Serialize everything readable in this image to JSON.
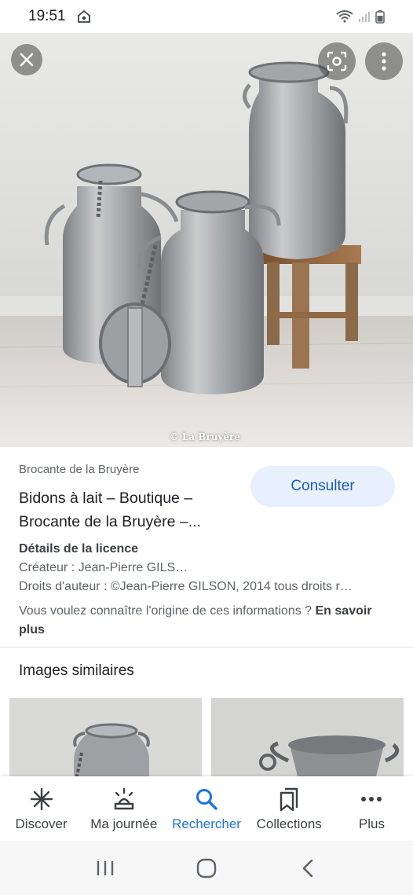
{
  "status_bar": {
    "time": "19:51"
  },
  "hero": {
    "credit": "© La Bruyère"
  },
  "result": {
    "source": "Brocante de la Bruyère",
    "title": "Bidons à lait – Boutique – Brocante de la Bruyère –...",
    "consult_label": "Consulter",
    "license_heading": "Détails de la licence",
    "creator": "Créateur : Jean-Pierre GILS…",
    "copyright": "Droits d'auteur : ©Jean-Pierre GILSON, 2014 tous droits r…",
    "origin_question": "Vous voulez connaître l'origine de ces informations ?",
    "origin_link": "En savoir plus"
  },
  "similar": {
    "heading": "Images similaires"
  },
  "bottom_nav": {
    "items": [
      {
        "label": "Discover",
        "icon": "asterisk-icon"
      },
      {
        "label": "Ma journée",
        "icon": "sunrise-icon"
      },
      {
        "label": "Rechercher",
        "icon": "search-icon",
        "active": true
      },
      {
        "label": "Collections",
        "icon": "bookmarks-icon"
      },
      {
        "label": "Plus",
        "icon": "more-horizontal-icon"
      }
    ]
  },
  "colors": {
    "accent": "#1a73e8",
    "button_bg": "#e8f0fe",
    "button_text": "#1a5bb8"
  }
}
